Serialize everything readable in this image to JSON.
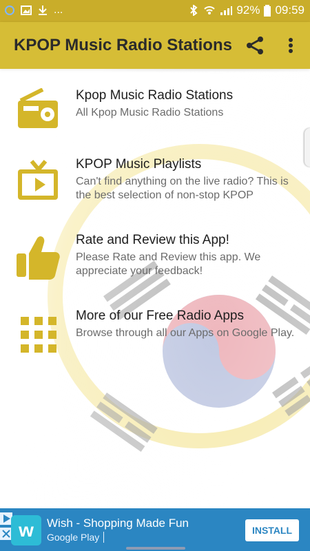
{
  "status": {
    "battery": "92%",
    "time": "09:59",
    "left_icons": [
      "sync-icon",
      "image-icon",
      "download-icon",
      "more-dots-icon"
    ],
    "left_text": "...",
    "right_icons": [
      "bluetooth-icon",
      "wifi-icon",
      "signal-icon",
      "battery-icon"
    ]
  },
  "appbar": {
    "title": "KPOP Music Radio Stations",
    "icons": [
      "share-icon",
      "more-vert-icon"
    ]
  },
  "list": [
    {
      "title": "Kpop Music Radio Stations",
      "subtitle": "All Kpop Music Radio Stations",
      "icon": "radio-icon"
    },
    {
      "title": "KPOP Music Playlists",
      "subtitle": "Can't find anything on the live radio? This is the best selection of non-stop KPOP",
      "icon": "tv-play-icon"
    },
    {
      "title": "Rate and Review this App!",
      "subtitle": "Please Rate and Review this app. We appreciate your feedback!",
      "icon": "thumbs-up-icon"
    },
    {
      "title": "More of our Free Radio Apps",
      "subtitle": "Browse through all our Apps on Google Play.",
      "icon": "grid-icon"
    }
  ],
  "ad": {
    "title": "Wish - Shopping Made Fun",
    "subtitle": "Google Play",
    "install": "INSTALL",
    "icons": [
      "wish-logo-icon",
      "play-icon",
      "close-icon"
    ]
  },
  "colors": {
    "accent": "#d6bd36",
    "status_bar": "#c9ad2a",
    "icon_gold": "#d4b62a",
    "ad_blue": "#2b86c2"
  }
}
